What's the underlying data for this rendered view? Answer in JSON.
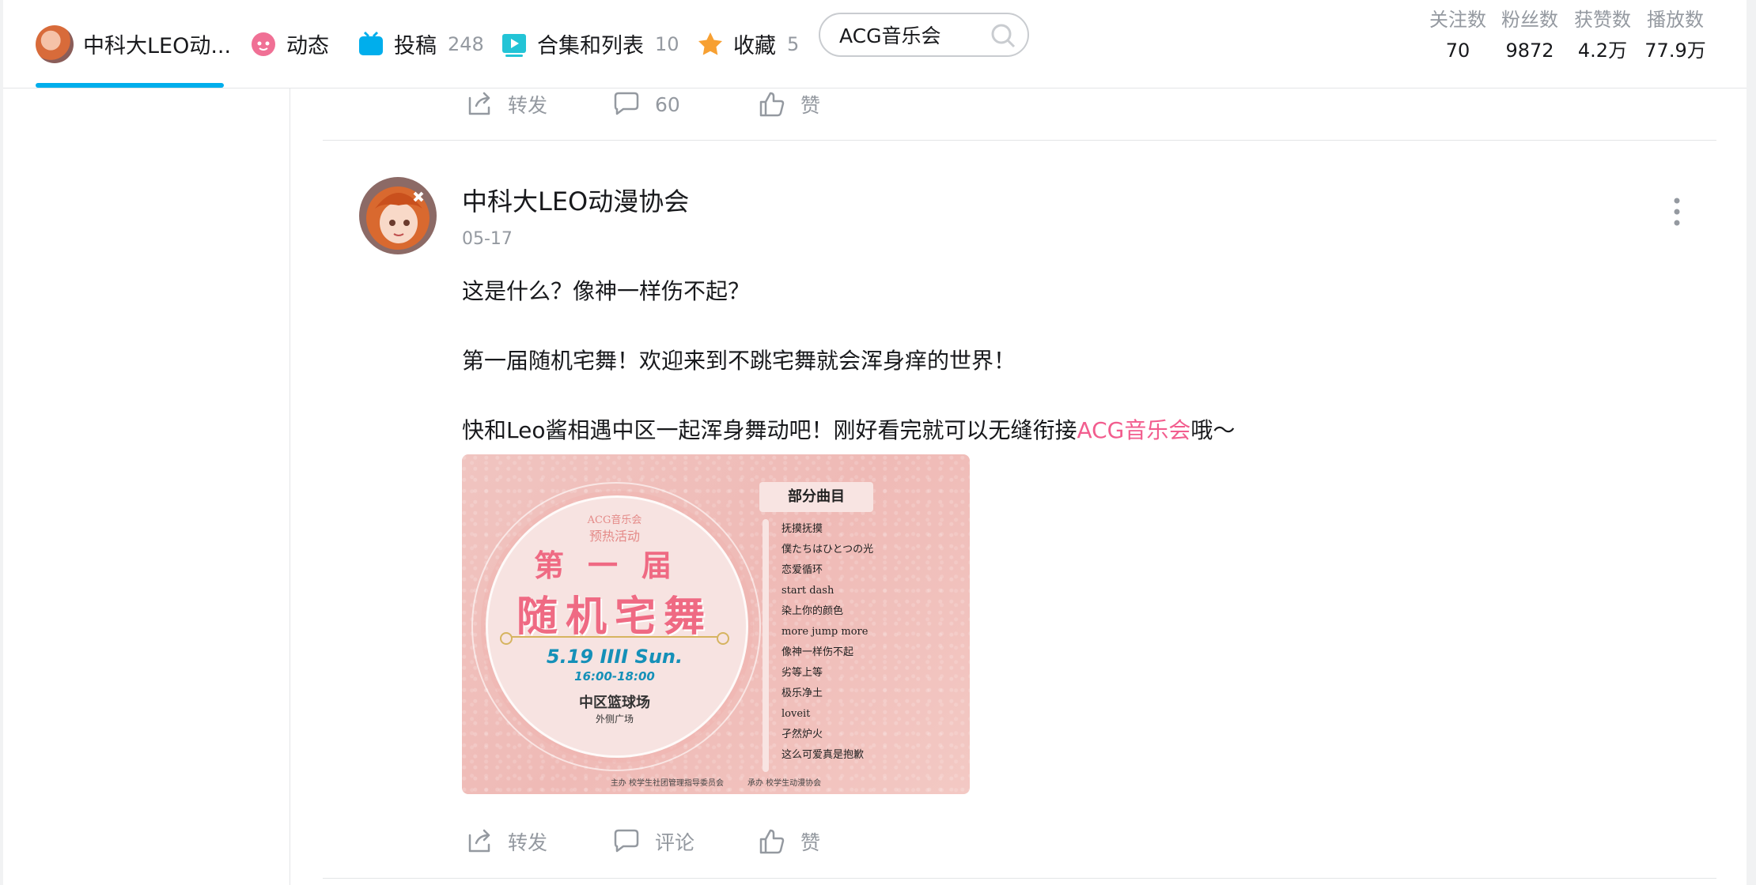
{
  "nav": {
    "channel_name": "中科大LEO动...",
    "tabs": [
      {
        "label": "动态",
        "count": ""
      },
      {
        "label": "投稿",
        "count": "248"
      },
      {
        "label": "合集和列表",
        "count": "10"
      },
      {
        "label": "收藏",
        "count": "5"
      }
    ],
    "search_value": "ACG音乐会",
    "stats": [
      {
        "label": "关注数",
        "value": "70"
      },
      {
        "label": "粉丝数",
        "value": "9872"
      },
      {
        "label": "获赞数",
        "value": "4.2万"
      },
      {
        "label": "播放数",
        "value": "77.9万"
      }
    ],
    "accent": "#00aeec"
  },
  "prev_post_actions": {
    "repost": "转发",
    "comment": "60",
    "like": "赞"
  },
  "post": {
    "author": "中科大LEO动漫协会",
    "date": "05-17",
    "para1": "这是什么？像神一样伤不起？",
    "para2": "第一届随机宅舞！欢迎来到不跳宅舞就会浑身痒的世界！",
    "para3_before": "快和Leo酱相遇中区一起浑身舞动吧！刚好看完就可以无缝衔接",
    "para3_link": "ACG音乐会",
    "para3_after": "哦～",
    "link_color": "#f25d8e",
    "actions": {
      "repost": "转发",
      "comment": "评论",
      "like": "赞"
    },
    "poster": {
      "sub1": "ACG音乐会",
      "sub2": "预热活动",
      "title1": "第一届",
      "title2": "随机宅舞",
      "date": "5.19 IIII Sun.",
      "time": "16:00-18:00",
      "place": "中区篮球场",
      "place2": "外侧广场",
      "songs_header": "部分曲目",
      "songs": [
        "抚摸抚摸",
        "僕たちはひとつの光",
        "恋爱循环",
        "start dash",
        "染上你的颜色",
        "more jump more",
        "像神一样伤不起",
        "劣等上等",
        "极乐净土",
        "loveit",
        "孑然炉火",
        "这么可爱真是抱歉"
      ],
      "footer": "主办 校学生社团管理指导委员会　　　承办 校学生动漫协会"
    }
  }
}
